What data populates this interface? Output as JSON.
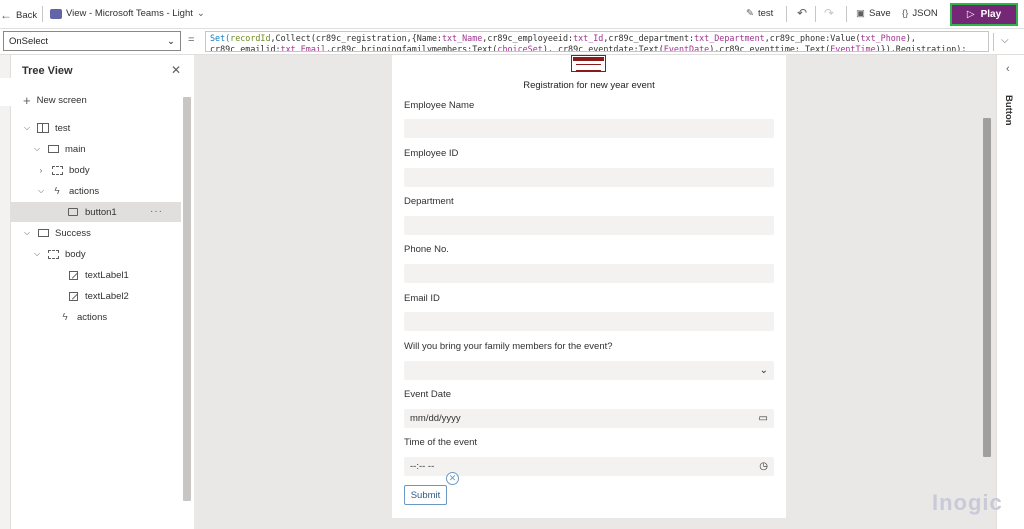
{
  "topbar": {
    "back_label": "Back",
    "app_title": "View - Microsoft Teams - Light",
    "test_label": "test",
    "save_label": "Save",
    "json_label": "JSON",
    "play_label": "Play"
  },
  "formula_bar": {
    "property": "OnSelect",
    "fx": "=",
    "line1_parts": [
      {
        "t": "Set(",
        "c": "fn"
      },
      {
        "t": "recordId",
        "c": "ref"
      },
      {
        "t": ",Collect(cr89c_registration,{Name:",
        "c": ""
      },
      {
        "t": "txt_Name",
        "c": "ctl"
      },
      {
        "t": ",cr89c_employeeid:",
        "c": ""
      },
      {
        "t": "txt_Id",
        "c": "ctl"
      },
      {
        "t": ",cr89c_department:",
        "c": ""
      },
      {
        "t": "txt_Department",
        "c": "ctl"
      },
      {
        "t": ",cr89c_phone:Value(",
        "c": ""
      },
      {
        "t": "txt_Phone",
        "c": "ctl"
      },
      {
        "t": "),",
        "c": ""
      }
    ],
    "line2_parts": [
      {
        "t": "cr89c_emailid:",
        "c": ""
      },
      {
        "t": "txt_Email",
        "c": "ctl"
      },
      {
        "t": ",cr89c_bringingfamilymembers:Text(",
        "c": ""
      },
      {
        "t": "choiceSet",
        "c": "ctl"
      },
      {
        "t": "), cr89c_eventdate:Text(",
        "c": ""
      },
      {
        "t": "EventDate",
        "c": "ctl"
      },
      {
        "t": "),cr89c_eventtime: Text(",
        "c": ""
      },
      {
        "t": "EventTime",
        "c": "ctl"
      },
      {
        "t": ")}),Registration);",
        "c": ""
      }
    ]
  },
  "tree": {
    "title": "Tree View",
    "new_screen": "New screen",
    "nodes": [
      {
        "label": "test",
        "icon": "app-icon",
        "chev": "⌵"
      },
      {
        "label": "main",
        "icon": "screen-icon",
        "chev": "⌵"
      },
      {
        "label": "body",
        "icon": "group-icon",
        "chev": "›"
      },
      {
        "label": "actions",
        "icon": "lightning-icon",
        "chev": "⌵"
      },
      {
        "label": "button1",
        "icon": "button-icon",
        "chev": ""
      },
      {
        "label": "Success",
        "icon": "screen-icon",
        "chev": "⌵"
      },
      {
        "label": "body",
        "icon": "group-icon",
        "chev": "⌵"
      },
      {
        "label": "textLabel1",
        "icon": "label-icon",
        "chev": ""
      },
      {
        "label": "textLabel2",
        "icon": "label-icon",
        "chev": ""
      },
      {
        "label": "actions",
        "icon": "lightning-icon",
        "chev": ""
      }
    ],
    "more": "···"
  },
  "form": {
    "title": "Registration for new year event",
    "fields": [
      {
        "label": "Employee Name",
        "value": "",
        "suffix": ""
      },
      {
        "label": "Employee ID",
        "value": "",
        "suffix": ""
      },
      {
        "label": "Department",
        "value": "",
        "suffix": ""
      },
      {
        "label": "Phone No.",
        "value": "",
        "suffix": ""
      },
      {
        "label": "Email ID",
        "value": "",
        "suffix": ""
      },
      {
        "label": "Will you bring your family members for the event?",
        "value": "",
        "suffix": "⌄"
      },
      {
        "label": "Event Date",
        "value": "mm/dd/yyyy",
        "suffix": "▭"
      },
      {
        "label": "Time of the event",
        "value": "--:-- --",
        "suffix": "◷"
      }
    ],
    "submit": "Submit"
  },
  "right_panel": {
    "label": "Button"
  },
  "watermark": "Inogic",
  "colors": {
    "play_bg": "#742774",
    "play_border": "#2fb34a",
    "formula_control": "#a0328f",
    "formula_function": "#0f7ac4"
  }
}
